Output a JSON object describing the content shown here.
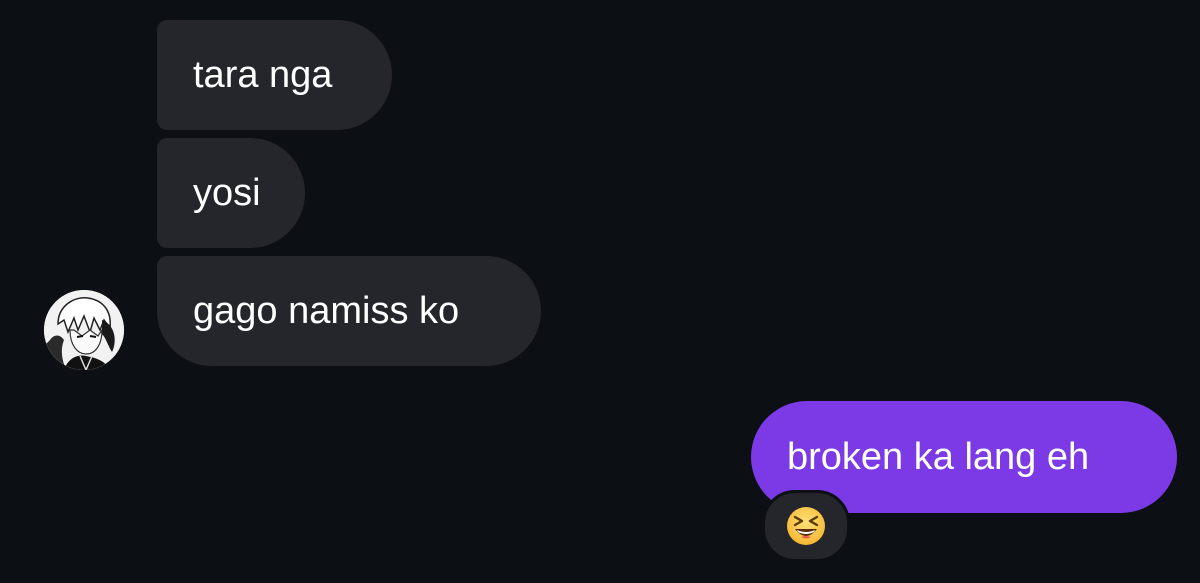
{
  "colors": {
    "background": "#0c0f14",
    "incoming_bubble": "#24262b",
    "outgoing_bubble": "#7b3ae6",
    "text": "#ffffff"
  },
  "conversation": {
    "incoming_messages": [
      {
        "text": "tara nga"
      },
      {
        "text": "yosi"
      },
      {
        "text": "gago namiss ko"
      }
    ],
    "outgoing_messages": [
      {
        "text": "broken ka lang eh",
        "reaction": "laughing-face-emoji"
      }
    ],
    "contact_avatar_icon": "anime-profile-picture"
  }
}
